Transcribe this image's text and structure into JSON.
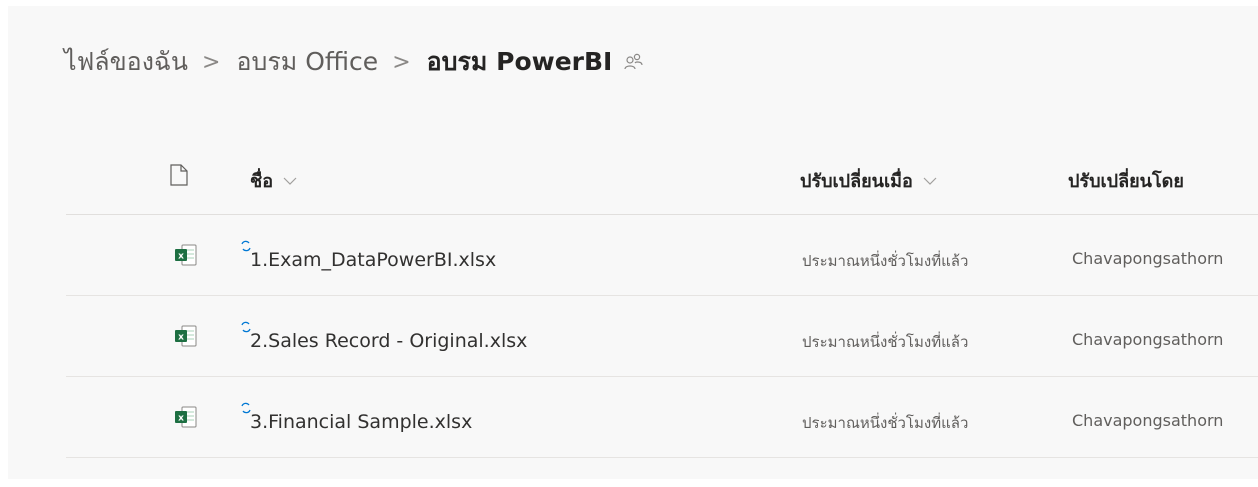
{
  "breadcrumb": {
    "items": [
      "ไฟล์ของฉัน",
      "อบรม Office",
      "อบรม PowerBI"
    ],
    "separator": ">",
    "share_icon": "shared-people-icon"
  },
  "columns": {
    "file_type_icon": "document-icon",
    "name": "ชื่อ",
    "modified": "ปรับเปลี่ยนเมื่อ",
    "modified_by": "ปรับเปลี่ยนโดย"
  },
  "files": [
    {
      "name": "1.Exam_DataPowerBI.xlsx",
      "modified": "ประมาณหนึ่งชั่วโมงที่แล้ว",
      "modified_by": "Chavapongsathorn",
      "icon": "excel-file-icon",
      "status_icon": "sync-icon"
    },
    {
      "name": "2.Sales Record - Original.xlsx",
      "modified": "ประมาณหนึ่งชั่วโมงที่แล้ว",
      "modified_by": "Chavapongsathorn",
      "icon": "excel-file-icon",
      "status_icon": "sync-icon"
    },
    {
      "name": "3.Financial Sample.xlsx",
      "modified": "ประมาณหนึ่งชั่วโมงที่แล้ว",
      "modified_by": "Chavapongsathorn",
      "icon": "excel-file-icon",
      "status_icon": "sync-icon"
    }
  ],
  "colors": {
    "excel_green": "#1d6f42",
    "sync_blue": "#0078d4"
  }
}
